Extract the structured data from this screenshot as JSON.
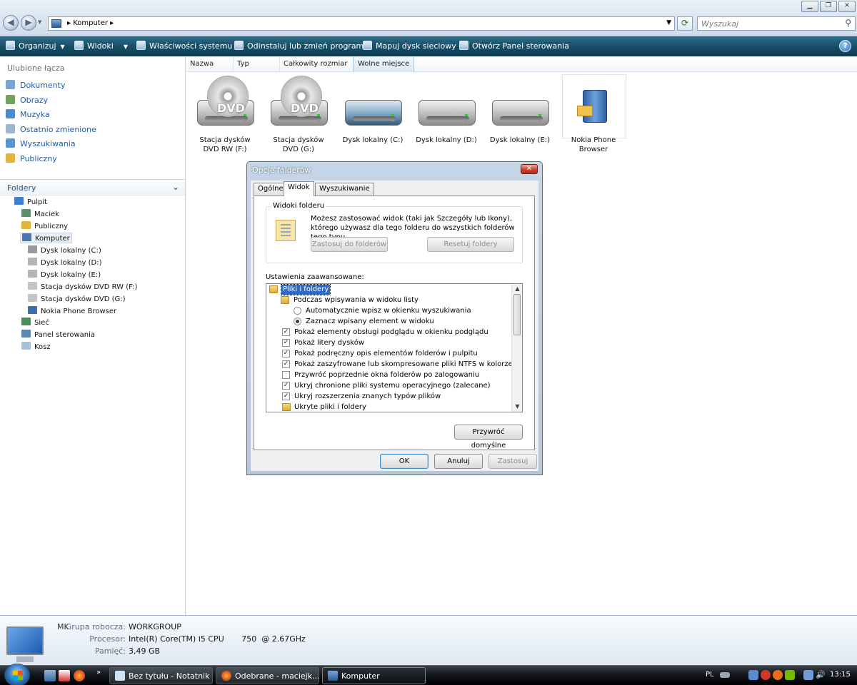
{
  "window": {
    "breadcrumb": "Komputer",
    "search_placeholder": "Wyszukaj"
  },
  "toolbar": {
    "organize": "Organizuj",
    "views": "Widoki",
    "system_properties": "Właściwości systemu",
    "uninstall": "Odinstaluj lub zmień program",
    "map_drive": "Mapuj dysk sieciowy",
    "control_panel": "Otwórz Panel sterowania"
  },
  "sidebar": {
    "favorites_title": "Ulubione łącza",
    "favorites": [
      "Dokumenty",
      "Obrazy",
      "Muzyka",
      "Ostatnio zmienione",
      "Wyszukiwania",
      "Publiczny"
    ],
    "folders_title": "Foldery",
    "tree": [
      "Pulpit",
      "Maciek",
      "Publiczny",
      "Komputer",
      "Dysk lokalny (C:)",
      "Dysk lokalny (D:)",
      "Dysk lokalny (E:)",
      "Stacja dysków DVD RW (F:)",
      "Stacja dysków DVD (G:)",
      "Nokia Phone Browser",
      "Sieć",
      "Panel sterowania",
      "Kosz"
    ]
  },
  "columns": [
    "Nazwa",
    "Typ",
    "Całkowity rozmiar",
    "Wolne miejsce"
  ],
  "items": [
    {
      "label": "Stacja dysków DVD RW (F:)",
      "kind": "dvd",
      "icon_text": "DVD"
    },
    {
      "label": "Stacja dysków DVD (G:)",
      "kind": "dvd",
      "icon_text": "DVD"
    },
    {
      "label": "Dysk lokalny (C:)",
      "kind": "hdd-system"
    },
    {
      "label": "Dysk lokalny (D:)",
      "kind": "hdd"
    },
    {
      "label": "Dysk lokalny (E:)",
      "kind": "hdd"
    },
    {
      "label": "Nokia Phone Browser",
      "kind": "nokia"
    }
  ],
  "dialog": {
    "title": "Opcje folderów",
    "tabs": [
      "Ogólne",
      "Widok",
      "Wyszukiwanie"
    ],
    "active_tab": "Widok",
    "group_title": "Widoki folderu",
    "group_desc": "Możesz zastosować widok (taki jak Szczegóły lub Ikony), którego używasz dla tego folderu do wszystkich folderów tego typu.",
    "apply_btn": "Zastosuj do folderów",
    "reset_btn": "Resetuj foldery",
    "advanced_label": "Ustawienia zaawansowane:",
    "advanced": [
      {
        "type": "folder",
        "text": "Pliki i foldery",
        "level": 0
      },
      {
        "type": "folder",
        "text": "Podczas wpisywania w widoku listy",
        "level": 1
      },
      {
        "type": "radio",
        "text": "Automatycznie wpisz w okienku wyszukiwania",
        "level": 2,
        "checked": false
      },
      {
        "type": "radio",
        "text": "Zaznacz wpisany element w widoku",
        "level": 2,
        "checked": true
      },
      {
        "type": "check",
        "text": "Pokaż elementy obsługi podglądu w okienku podglądu",
        "level": 1,
        "checked": true
      },
      {
        "type": "check",
        "text": "Pokaż litery dysków",
        "level": 1,
        "checked": true
      },
      {
        "type": "check",
        "text": "Pokaż podręczny opis elementów folderów i pulpitu",
        "level": 1,
        "checked": true
      },
      {
        "type": "check",
        "text": "Pokaż zaszyfrowane lub skompresowane pliki NTFS w kolorze",
        "level": 1,
        "checked": true
      },
      {
        "type": "check",
        "text": "Przywróć poprzednie okna folderów po zalogowaniu",
        "level": 1,
        "checked": false
      },
      {
        "type": "check",
        "text": "Ukryj chronione pliki systemu operacyjnego (zalecane)",
        "level": 1,
        "checked": true
      },
      {
        "type": "check",
        "text": "Ukryj rozszerzenia znanych typów plików",
        "level": 1,
        "checked": true
      },
      {
        "type": "folder",
        "text": "Ukryte pliki i foldery",
        "level": 1
      }
    ],
    "restore_btn": "Przywróć domyślne",
    "ok": "OK",
    "cancel": "Anuluj",
    "apply": "Zastosuj"
  },
  "details": {
    "initials": "MK",
    "workgroup_label": "Grupa robocza:",
    "workgroup": "WORKGROUP",
    "cpu_label": "Procesor:",
    "cpu": "Intel(R) Core(TM) i5 CPU       750  @ 2.67GHz",
    "ram_label": "Pamięć:",
    "ram": "3,49 GB"
  },
  "taskbar": {
    "tasks": [
      "Bez tytułu - Notatnik",
      "Odebrane - maciejk...",
      "Komputer"
    ],
    "lang": "PL",
    "time": "13:15"
  }
}
